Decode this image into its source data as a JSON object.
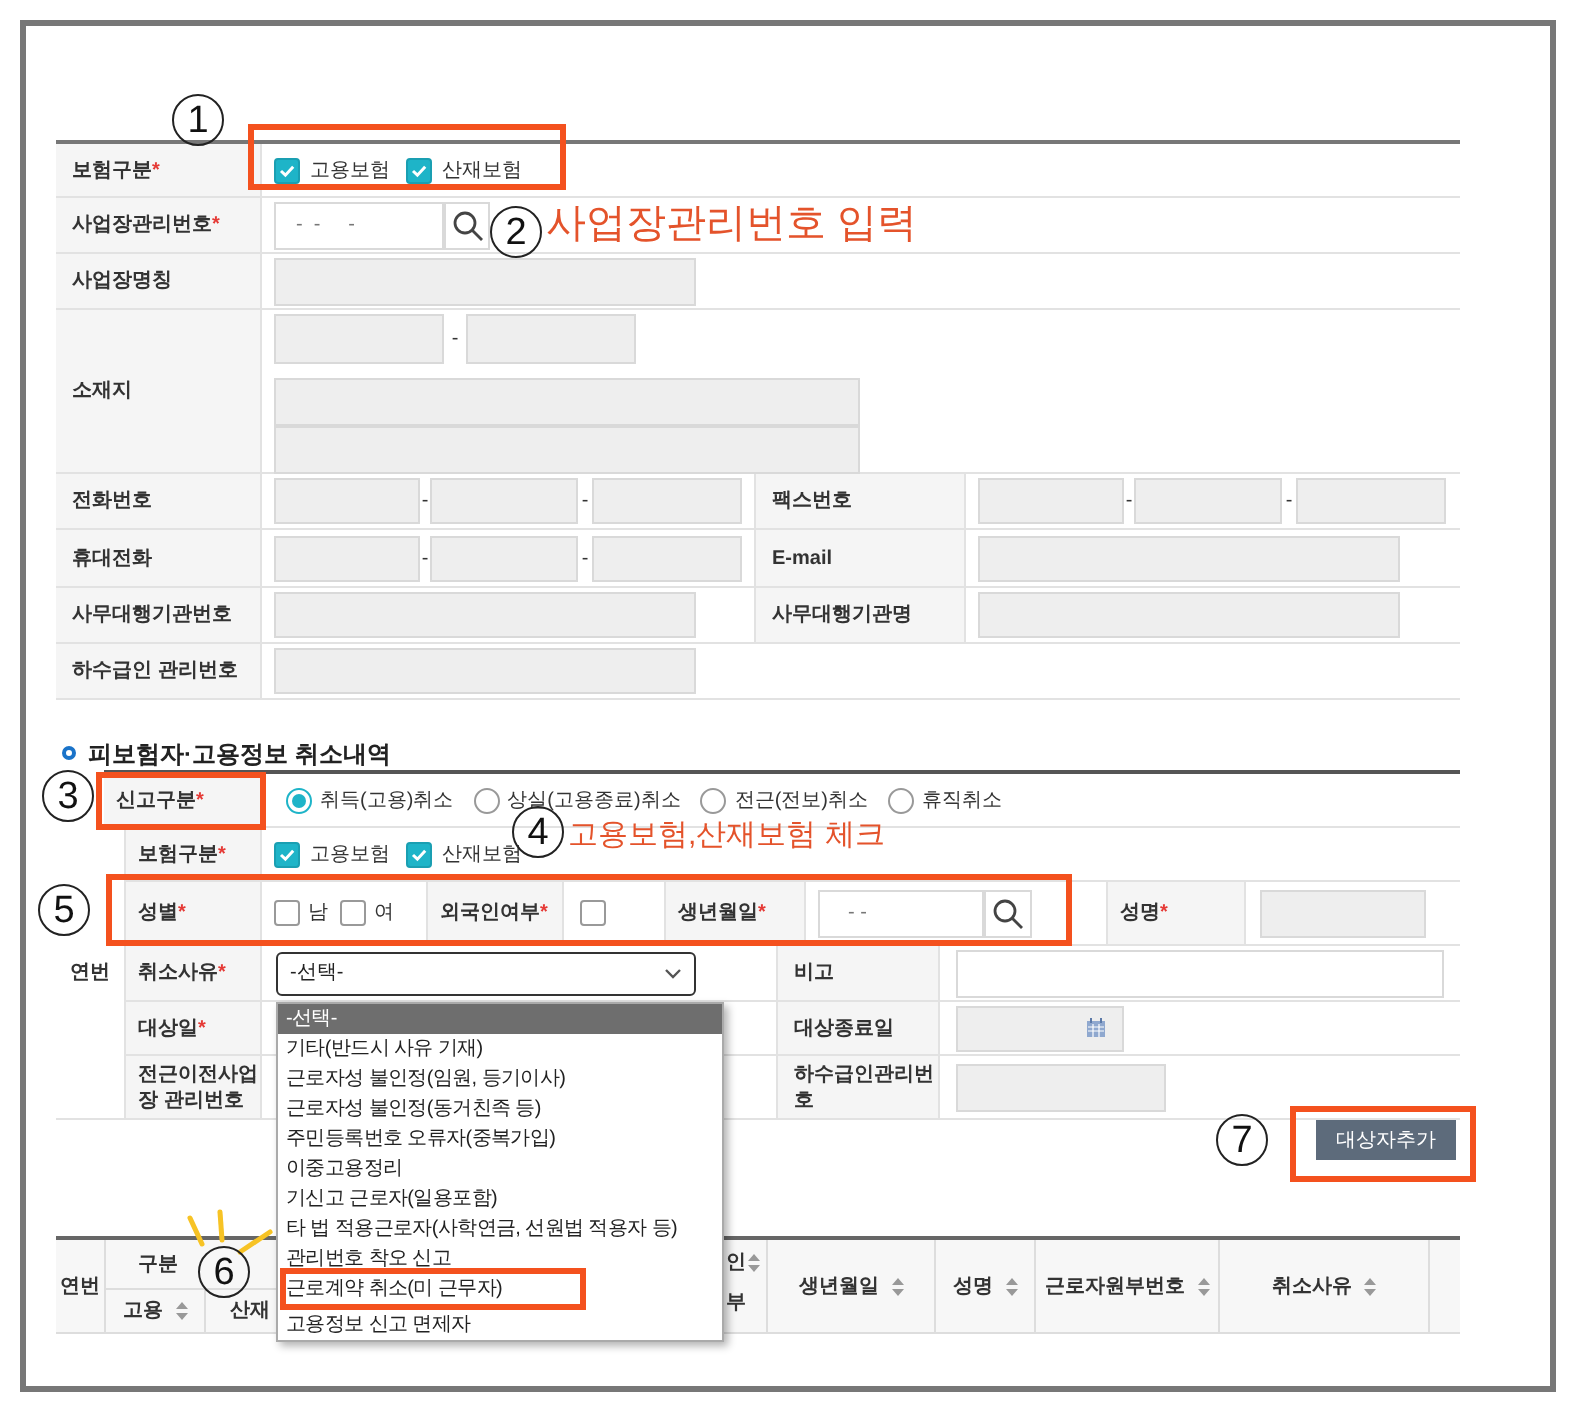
{
  "workplace": {
    "insurance_type": {
      "label": "보험구분",
      "mark": "*",
      "options": [
        {
          "label": "고용보험",
          "checked": true
        },
        {
          "label": "산재보험",
          "checked": true
        }
      ]
    },
    "workplace_number": {
      "label": "사업장관리번호",
      "mark": "*",
      "placeholder": "-  -     -"
    },
    "workplace_name": {
      "label": "사업장명칭"
    },
    "address": {
      "label": "소재지",
      "separator": "-"
    },
    "phone": {
      "label": "전화번호",
      "separators": [
        "-",
        "-"
      ]
    },
    "fax": {
      "label": "팩스번호",
      "separators": [
        "-",
        "-"
      ]
    },
    "mobile": {
      "label": "휴대전화",
      "separators": [
        "-",
        "-"
      ]
    },
    "email": {
      "label": "E-mail"
    },
    "agency_number": {
      "label": "사무대행기관번호"
    },
    "agency_name": {
      "label": "사무대행기관명"
    },
    "subcontractor_number": {
      "label": "하수급인 관리번호"
    }
  },
  "section_title": "피보험자·고용정보 취소내역",
  "cancellation": {
    "report_type": {
      "label": "신고구분",
      "mark": "*",
      "options": [
        {
          "label": "취득(고용)취소",
          "selected": true
        },
        {
          "label": "상실(고용종료)취소",
          "selected": false
        },
        {
          "label": "전근(전보)취소",
          "selected": false
        },
        {
          "label": "휴직취소",
          "selected": false
        }
      ]
    },
    "row_number_label": "연번",
    "insurance_type": {
      "label": "보험구분",
      "mark": "*",
      "options": [
        {
          "label": "고용보험",
          "checked": true
        },
        {
          "label": "산재보험",
          "checked": true
        }
      ]
    },
    "gender": {
      "label": "성별",
      "mark": "*",
      "options": [
        {
          "label": "남",
          "checked": false
        },
        {
          "label": "여",
          "checked": false
        }
      ]
    },
    "foreigner": {
      "label": "외국인여부",
      "mark": "*",
      "checked": false
    },
    "birth_date": {
      "label": "생년월일",
      "mark": "*",
      "placeholder": "- -"
    },
    "name": {
      "label": "성명",
      "mark": "*"
    },
    "cancel_reason": {
      "label": "취소사유",
      "mark": "*",
      "value": "-선택-",
      "expanded": true,
      "options": [
        {
          "label": "-선택-",
          "selected": true
        },
        {
          "label": "기타(반드시 사유 기재)",
          "selected": false
        },
        {
          "label": "근로자성 불인정(임원, 등기이사)",
          "selected": false
        },
        {
          "label": "근로자성 불인정(동거친족 등)",
          "selected": false
        },
        {
          "label": "주민등록번호 오류자(중복가입)",
          "selected": false
        },
        {
          "label": "이중고용정리",
          "selected": false
        },
        {
          "label": "기신고 근로자(일용포함)",
          "selected": false
        },
        {
          "label": "타 법 적용근로자(사학연금, 선원법 적용자 등)",
          "selected": false
        },
        {
          "label": "관리번호 착오 신고",
          "selected": false
        },
        {
          "label": "근로계약 취소(미 근무자)",
          "selected": false
        },
        {
          "label": "고용정보 신고 면제자",
          "selected": false
        }
      ]
    },
    "note": {
      "label": "비고"
    },
    "target_date": {
      "label": "대상일",
      "mark": "*"
    },
    "target_end_date": {
      "label": "대상종료일"
    },
    "previous_workplace": {
      "label": "전근이전사업장 관리번호"
    },
    "subcontractor_number": {
      "label": "하수급인관리번호"
    },
    "add_button": "대상자추가"
  },
  "results_table": {
    "columns": [
      {
        "label": "연번",
        "sortable": false
      },
      {
        "label": "구분",
        "sortable": false,
        "children": [
          {
            "label": "고용",
            "sortable": true
          },
          {
            "label": "산재",
            "sortable": false
          }
        ]
      },
      {
        "label": "인",
        "label_2": "부",
        "sortable": true
      },
      {
        "label": "생년월일",
        "sortable": true
      },
      {
        "label": "성명",
        "sortable": true
      },
      {
        "label": "근로자원부번호",
        "sortable": true
      },
      {
        "label": "취소사유",
        "sortable": true
      }
    ]
  },
  "callouts": [
    {
      "number": "1"
    },
    {
      "number": "2",
      "note": "사업장관리번호 입력"
    },
    {
      "number": "3"
    },
    {
      "number": "4",
      "note": "고용보험,산재보험 체크"
    },
    {
      "number": "5"
    },
    {
      "number": "6"
    },
    {
      "number": "7"
    }
  ]
}
